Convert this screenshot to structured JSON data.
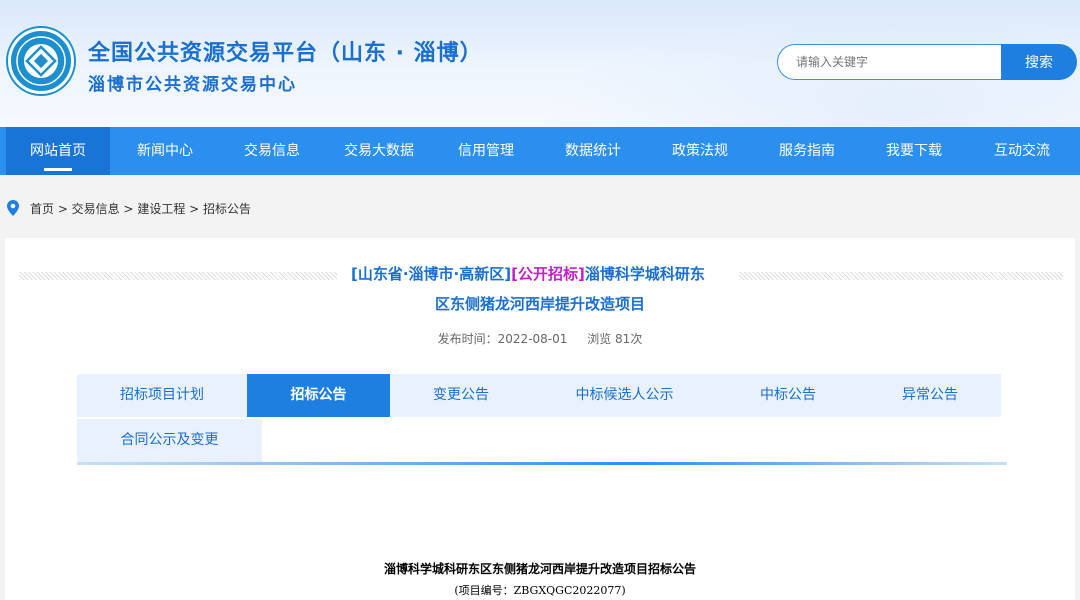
{
  "header": {
    "title": "全国公共资源交易平台（山东 · 淄博）",
    "subtitle": "淄博市公共资源交易中心",
    "logo_icon": "emblem-icon"
  },
  "search": {
    "placeholder": "请输入关键字",
    "button_label": "搜索"
  },
  "nav": {
    "items": [
      {
        "label": "网站首页",
        "active": true
      },
      {
        "label": "新闻中心"
      },
      {
        "label": "交易信息"
      },
      {
        "label": "交易大数据"
      },
      {
        "label": "信用管理"
      },
      {
        "label": "数据统计"
      },
      {
        "label": "政策法规"
      },
      {
        "label": "服务指南"
      },
      {
        "label": "我要下载"
      },
      {
        "label": "互动交流"
      }
    ]
  },
  "breadcrumb": {
    "icon": "location-pin-icon",
    "text": "首页 > 交易信息 > 建设工程 > 招标公告"
  },
  "article": {
    "region": "[山东省·淄博市·高新区]",
    "type": "[公开招标]",
    "title_part1": "淄博科学城科研东",
    "title_part2": "区东侧猪龙河西岸提升改造项目",
    "publish_time": "发布时间：2022-08-01",
    "views": "浏览 81次",
    "doc_title": "淄博科学城科研东区东侧猪龙河西岸提升改造项目招标公告",
    "doc_no": "(项目编号：ZBGXQGC2022077)"
  },
  "tabs": [
    {
      "label": "招标项目计划"
    },
    {
      "label": "招标公告",
      "active": true
    },
    {
      "label": "变更公告"
    },
    {
      "label": "中标候选人公示"
    },
    {
      "label": "中标公告"
    },
    {
      "label": "异常公告"
    },
    {
      "label": "合同公示及变更"
    }
  ],
  "colors": {
    "brand_blue": "#1a6fcf",
    "nav_blue": "#2b8ff0",
    "highlight_magenta": "#c21fc9"
  }
}
